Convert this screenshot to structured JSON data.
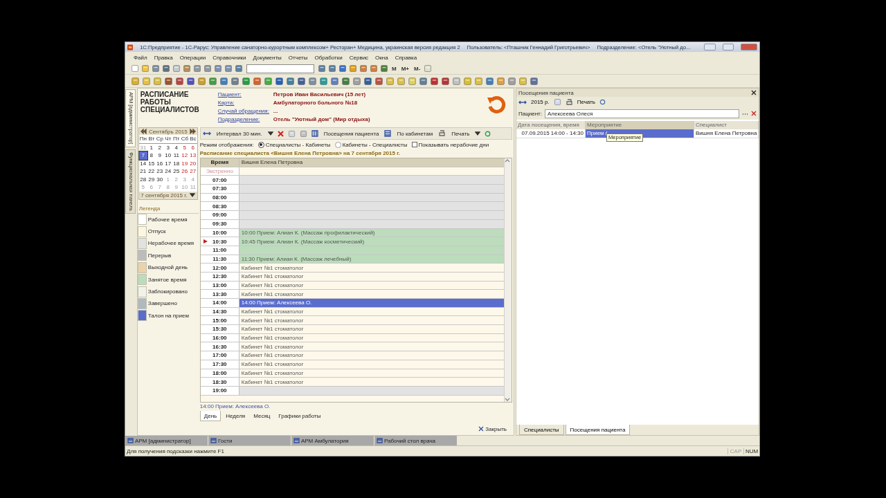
{
  "window": {
    "title": "1С:Предприятие - 1С-Рарус: Управление санаторно-курортным комплексом+ Ресторан+ Медицина, украинская версия редакция 2",
    "user": "Пользователь: <Пташник Геннадий Григотрьевич>",
    "division": "Подразделение: <Отель \"Уютный до..."
  },
  "menu": [
    "Файл",
    "Правка",
    "Операции",
    "Справочники",
    "Документы",
    "Отчеты",
    "Обработки",
    "Сервис",
    "Окна",
    "Справка"
  ],
  "toolbar_buttons": [
    "M",
    "M+",
    "M-"
  ],
  "side_tabs": [
    {
      "label": "АРМ [администратор]",
      "selected": true
    },
    {
      "label": "Функциональная панель",
      "selected": false
    }
  ],
  "header": {
    "title": "РАСПИСАНИЕ РАБОТЫ СПЕЦИАЛИСТОВ",
    "fields": [
      {
        "label": "Пациент:",
        "value": "Петров Иван Васильевич (15 лет)"
      },
      {
        "label": "Карта:",
        "value": "Амбулаторного больного №18"
      },
      {
        "label": "Случай обращения:",
        "value": "..."
      },
      {
        "label": "Подразделение:",
        "value": "Отель \"Уютный дом\" (Мир отдыха)"
      }
    ]
  },
  "calendar": {
    "month": "Сентябрь 2015",
    "weekdays": [
      "Пн",
      "Вт",
      "Ср",
      "Чт",
      "Пт",
      "Сб",
      "Вс"
    ],
    "date": "7 сентября 2015 г.",
    "days": [
      {
        "day": "31",
        "kind": "other",
        "selected": false
      },
      {
        "day": "1",
        "kind": "work",
        "selected": false
      },
      {
        "day": "2",
        "kind": "work",
        "selected": false
      },
      {
        "day": "3",
        "kind": "work",
        "selected": false
      },
      {
        "day": "4",
        "kind": "work",
        "selected": false
      },
      {
        "day": "5",
        "kind": "weekend",
        "selected": false
      },
      {
        "day": "6",
        "kind": "weekend",
        "selected": false
      },
      {
        "day": "7",
        "kind": "work",
        "selected": true
      },
      {
        "day": "8",
        "kind": "work",
        "selected": false
      },
      {
        "day": "9",
        "kind": "work",
        "selected": false
      },
      {
        "day": "10",
        "kind": "work",
        "selected": false
      },
      {
        "day": "11",
        "kind": "work",
        "selected": false
      },
      {
        "day": "12",
        "kind": "weekend",
        "selected": false
      },
      {
        "day": "13",
        "kind": "weekend",
        "selected": false
      },
      {
        "day": "14",
        "kind": "work",
        "selected": false
      },
      {
        "day": "15",
        "kind": "work",
        "selected": false
      },
      {
        "day": "16",
        "kind": "work",
        "selected": false
      },
      {
        "day": "17",
        "kind": "work",
        "selected": false
      },
      {
        "day": "18",
        "kind": "work",
        "selected": false
      },
      {
        "day": "19",
        "kind": "weekend",
        "selected": false
      },
      {
        "day": "20",
        "kind": "weekend",
        "selected": false
      },
      {
        "day": "21",
        "kind": "work",
        "selected": false
      },
      {
        "day": "22",
        "kind": "work",
        "selected": false
      },
      {
        "day": "23",
        "kind": "work",
        "selected": false
      },
      {
        "day": "24",
        "kind": "work",
        "selected": false
      },
      {
        "day": "25",
        "kind": "work",
        "selected": false
      },
      {
        "day": "26",
        "kind": "weekend",
        "selected": false
      },
      {
        "day": "27",
        "kind": "weekend",
        "selected": false
      },
      {
        "day": "28",
        "kind": "work",
        "selected": false
      },
      {
        "day": "29",
        "kind": "work",
        "selected": false
      },
      {
        "day": "30",
        "kind": "work",
        "selected": false
      },
      {
        "day": "1",
        "kind": "other",
        "selected": false
      },
      {
        "day": "2",
        "kind": "other",
        "selected": false
      },
      {
        "day": "3",
        "kind": "other",
        "selected": false
      },
      {
        "day": "4",
        "kind": "other",
        "selected": false
      },
      {
        "day": "5",
        "kind": "other",
        "selected": false
      },
      {
        "day": "6",
        "kind": "other",
        "selected": false
      },
      {
        "day": "7",
        "kind": "other",
        "selected": false
      },
      {
        "day": "8",
        "kind": "other",
        "selected": false
      },
      {
        "day": "9",
        "kind": "other",
        "selected": false
      },
      {
        "day": "10",
        "kind": "other",
        "selected": false
      },
      {
        "day": "11",
        "kind": "other",
        "selected": false
      }
    ]
  },
  "legend": {
    "title": "Легенда",
    "items": [
      {
        "label": "Рабочее время",
        "color": "#ffffff"
      },
      {
        "label": "Отпуск",
        "color": "#fbf6e0"
      },
      {
        "label": "Нерабочее время",
        "color": "#e2e2e2"
      },
      {
        "label": "Перерыв",
        "color": "#bcbcbc"
      },
      {
        "label": "Выходной день",
        "color": "#ecd2a8"
      },
      {
        "label": "Занятое время",
        "color": "#bcdcbc"
      },
      {
        "label": "Заблокировано",
        "color": "#f2f2ea"
      },
      {
        "label": "Завершено",
        "color": "#b0b8c0"
      },
      {
        "label": "Талон на прием",
        "color": "#5a6ccc"
      }
    ]
  },
  "schedule": {
    "toolbar": {
      "interval": "Интервал 30 мин.",
      "visits": "Посещения пациента",
      "rooms": "По кабинетам",
      "print": "Печать"
    },
    "mode_label": "Режим отображения:",
    "modes": [
      {
        "label": "Специалисты - Кабинеты",
        "selected": true
      },
      {
        "label": "Кабинеты - Специалисты",
        "selected": false
      }
    ],
    "show_nonwork": {
      "label": "Показывать нерабочие дни",
      "checked": false
    },
    "heading": "Расписание специалиста <Вишня Елена Петровна> на 7 сентября 2015 г.",
    "columns": [
      "Время",
      "Вишня Елена Петровна"
    ],
    "rows": [
      {
        "time": "Экстренно",
        "text": "",
        "kind": "emergency",
        "current": false
      },
      {
        "time": "07:00",
        "text": "",
        "kind": "off",
        "current": false
      },
      {
        "time": "07:30",
        "text": "",
        "kind": "off",
        "current": false
      },
      {
        "time": "08:00",
        "text": "",
        "kind": "off",
        "current": false
      },
      {
        "time": "08:30",
        "text": "",
        "kind": "off",
        "current": false
      },
      {
        "time": "09:00",
        "text": "",
        "kind": "off",
        "current": false
      },
      {
        "time": "09:30",
        "text": "",
        "kind": "off",
        "current": false
      },
      {
        "time": "10:00",
        "text": "10:00 Прием: Алиан К. (Массаж профилактический)",
        "kind": "busy",
        "current": false
      },
      {
        "time": "10:30",
        "text": "10:45 Прием: Алиан К. (Массаж косметический)",
        "kind": "busy",
        "current": true
      },
      {
        "time": "11:00",
        "text": "",
        "kind": "busy",
        "current": false
      },
      {
        "time": "11:30",
        "text": "11:30 Прием: Алиан К. (Массаж лечебный)",
        "kind": "busy",
        "current": false
      },
      {
        "time": "12:00",
        "text": "Кабинет  №1 стоматолог",
        "kind": "free",
        "current": false
      },
      {
        "time": "12:30",
        "text": "Кабинет  №1 стоматолог",
        "kind": "free",
        "current": false
      },
      {
        "time": "13:00",
        "text": "Кабинет  №1 стоматолог",
        "kind": "free",
        "current": false
      },
      {
        "time": "13:30",
        "text": "Кабинет  №1 стоматолог",
        "kind": "free",
        "current": false
      },
      {
        "time": "14:00",
        "text": "14:00 Прием: Алексеева О.",
        "kind": "ticket",
        "current": false
      },
      {
        "time": "14:30",
        "text": "Кабинет  №1 стоматолог",
        "kind": "free",
        "current": false
      },
      {
        "time": "15:00",
        "text": "Кабинет  №1 стоматолог",
        "kind": "free",
        "current": false
      },
      {
        "time": "15:30",
        "text": "Кабинет  №1 стоматолог",
        "kind": "free",
        "current": false
      },
      {
        "time": "16:00",
        "text": "Кабинет  №1 стоматолог",
        "kind": "free",
        "current": false
      },
      {
        "time": "16:30",
        "text": "Кабинет  №1 стоматолог",
        "kind": "free",
        "current": false
      },
      {
        "time": "17:00",
        "text": "Кабинет  №1 стоматолог",
        "kind": "free",
        "current": false
      },
      {
        "time": "17:30",
        "text": "Кабинет  №1 стоматолог",
        "kind": "free",
        "current": false
      },
      {
        "time": "18:00",
        "text": "Кабинет  №1 стоматолог",
        "kind": "free",
        "current": false
      },
      {
        "time": "18:30",
        "text": "Кабинет  №1 стоматолог",
        "kind": "free",
        "current": false
      },
      {
        "time": "19:00",
        "text": "",
        "kind": "off",
        "current": false
      }
    ],
    "footer": "14:00 Прием: Алексеева О.",
    "tabs": [
      {
        "label": "День",
        "selected": true
      },
      {
        "label": "Неделя",
        "selected": false
      },
      {
        "label": "Месяц",
        "selected": false
      },
      {
        "label": "Графики работы",
        "selected": false
      }
    ]
  },
  "close_button": "Закрыть",
  "visits_panel": {
    "title": "Посещения пациента",
    "period": "2015 р.",
    "print": "Печать",
    "patient_label": "Пациент:",
    "patient": "Алексеева Олеся",
    "columns": [
      "Дата посещения, время",
      "Мероприятие",
      "Специалист"
    ],
    "rows": [
      {
        "cells": [
          "07.09.2015 14:00 - 14:30",
          "Прием (",
          "Вишня Елена Петровна"
        ],
        "selected": true
      }
    ],
    "tooltip": "Мероприятие",
    "tabs": [
      {
        "label": "Специалисты",
        "selected": false
      },
      {
        "label": "Посещения пациента",
        "selected": true
      }
    ]
  },
  "taskbar": [
    "АРМ [администратор]",
    "Гости",
    "АРМ Амбулатория",
    "Рабочий стол врача"
  ],
  "status_bar": {
    "hint": "Для получения подсказки нажмите F1",
    "indicators": [
      {
        "label": "CAP",
        "on": false
      },
      {
        "label": "NUM",
        "on": true
      }
    ]
  }
}
